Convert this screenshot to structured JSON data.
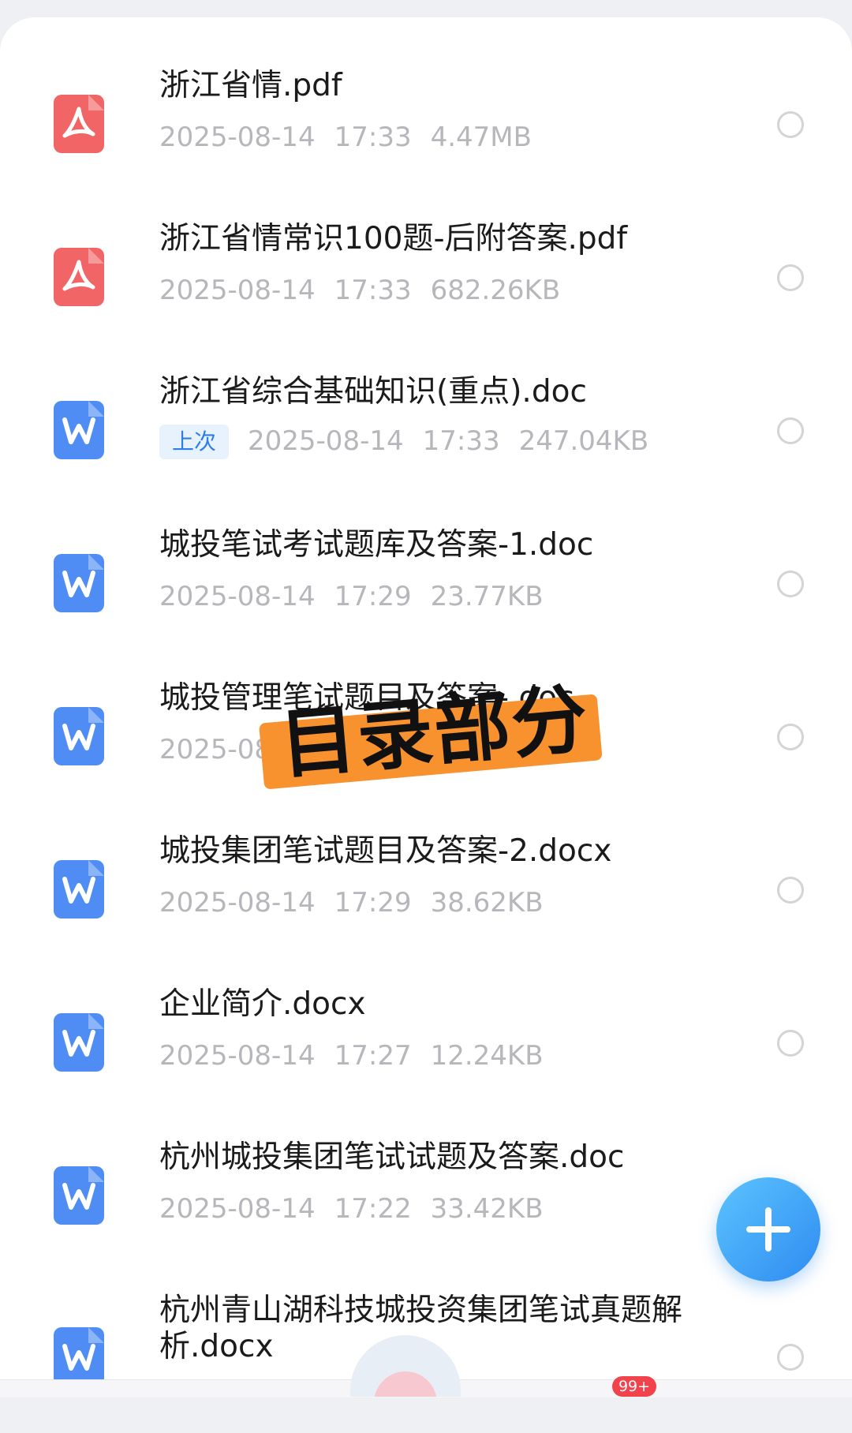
{
  "files": [
    {
      "name": "浙江省情.pdf",
      "tag": "",
      "date": "2025-08-14",
      "time": "17:33",
      "size": "4.47MB",
      "type": "pdf"
    },
    {
      "name": "浙江省情常识100题-后附答案.pdf",
      "tag": "",
      "date": "2025-08-14",
      "time": "17:33",
      "size": "682.26KB",
      "type": "pdf"
    },
    {
      "name": "浙江省综合基础知识(重点).doc",
      "tag": "上次",
      "date": "2025-08-14",
      "time": "17:33",
      "size": "247.04KB",
      "type": "doc"
    },
    {
      "name": "城投笔试考试题库及答案-1.doc",
      "tag": "",
      "date": "2025-08-14",
      "time": "17:29",
      "size": "23.77KB",
      "type": "doc"
    },
    {
      "name": "城投管理笔试题目及答案-.doc",
      "tag": "",
      "date": "2025-08",
      "time": "",
      "size": "",
      "type": "doc"
    },
    {
      "name": "城投集团笔试题目及答案-2.docx",
      "tag": "",
      "date": "2025-08-14",
      "time": "17:29",
      "size": "38.62KB",
      "type": "doc"
    },
    {
      "name": "企业简介.docx",
      "tag": "",
      "date": "2025-08-14",
      "time": "17:27",
      "size": "12.24KB",
      "type": "doc"
    },
    {
      "name": "杭州城投集团笔试试题及答案.doc",
      "tag": "",
      "date": "2025-08-14",
      "time": "17:22",
      "size": "33.42KB",
      "type": "doc"
    },
    {
      "name": "杭州青山湖科技城投资集团笔试真题解析.docx",
      "tag": "",
      "date": "",
      "time": "",
      "size": "",
      "type": "doc"
    }
  ],
  "overlay": {
    "label": "目录部分"
  },
  "fab": {
    "icon": "plus-icon"
  },
  "nav_badge": "99+",
  "colors": {
    "pdf": "#f26566",
    "doc": "#4f8df5",
    "accent": "#2e8bf0",
    "overlay": "#f7922f"
  }
}
